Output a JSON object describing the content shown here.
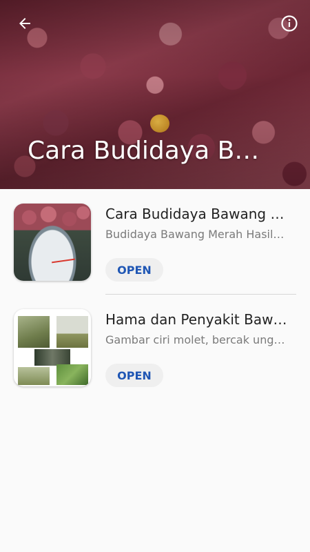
{
  "header": {
    "title": "Cara Budidaya Ba…",
    "back_icon": "arrow-back-icon",
    "info_icon": "info-icon"
  },
  "items": [
    {
      "title": "Cara Budidaya Bawang M…",
      "subtitle": "Budidaya Bawang Merah Hasil…",
      "button_label": "OPEN",
      "thumbnail": "onion-scale-photo"
    },
    {
      "title": "Hama dan Penyakit Bawa…",
      "subtitle": "Gambar ciri molet, bercak ungu…",
      "button_label": "OPEN",
      "thumbnail": "pest-collage-photo"
    }
  ],
  "colors": {
    "accent": "#1f56b4",
    "button_bg": "#efefef",
    "title_text": "#212121",
    "subtitle_text": "#7a7a7a"
  }
}
